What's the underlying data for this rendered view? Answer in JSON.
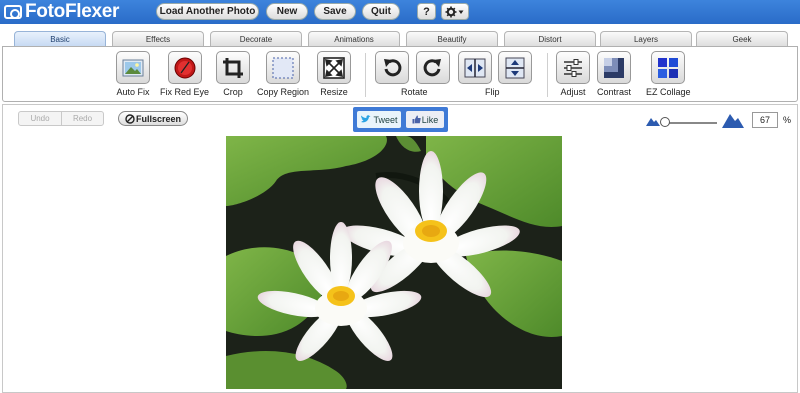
{
  "app": {
    "name": "FotoFlexer"
  },
  "toolbar": {
    "load_label": "Load Another Photo",
    "new_label": "New",
    "save_label": "Save",
    "quit_label": "Quit",
    "help_label": "?"
  },
  "tabs": [
    "Basic",
    "Effects",
    "Decorate",
    "Animations",
    "Beautify",
    "Distort",
    "Layers",
    "Geek"
  ],
  "tools": {
    "auto_fix": "Auto Fix",
    "fix_red_eye": "Fix Red Eye",
    "crop": "Crop",
    "copy_region": "Copy Region",
    "resize": "Resize",
    "rotate": "Rotate",
    "flip": "Flip",
    "adjust": "Adjust",
    "contrast": "Contrast",
    "ez_collage": "EZ Collage"
  },
  "edit": {
    "undo": "Undo",
    "redo": "Redo",
    "fullscreen": "Fullscreen"
  },
  "social": {
    "tweet": "Tweet",
    "like": "Like"
  },
  "zoom": {
    "value": "67",
    "unit": "%"
  },
  "colors": {
    "brand": "#2f73d0",
    "active_tab": "#c7daf3"
  }
}
